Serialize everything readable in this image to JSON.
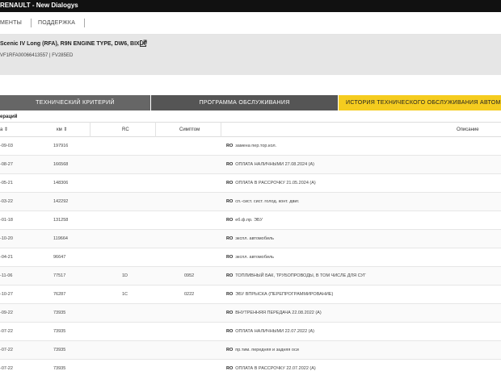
{
  "app": {
    "title": "RENAULT - New Dialogys"
  },
  "menu": {
    "items": [
      "МЕНТЫ",
      "ПОДДЕРЖКА"
    ]
  },
  "vehicle": {
    "title": "Scenic IV Long (RFA), R9N ENGINE TYPE, DW6, BIXUF",
    "subtitle": "VF1RFA00066413557 | FV285ED"
  },
  "tabs": [
    {
      "label": "ТЕХНИЧЕСКИЙ КРИТЕРИЙ",
      "active": false
    },
    {
      "label": "ПРОГРАММА ОБСЛУЖИВАНИЯ",
      "active": false
    },
    {
      "label": "ИСТОРИЯ ТЕХНИЧЕСКОГО ОБСЛУЖИВАНИЯ АВТОМОБИЛЯ",
      "active": true
    }
  ],
  "section_title": "ераций",
  "table": {
    "headers": {
      "date": "а ⇕",
      "km": "км ⇕",
      "rc": "RC",
      "symptom": "Симптом",
      "description": "Описание"
    },
    "badge": "RO",
    "rows": [
      {
        "date": "-09-03",
        "km": "197916",
        "rc": "",
        "symptom": "",
        "description": "замена пер.тор.кол."
      },
      {
        "date": "-08-27",
        "km": "166568",
        "rc": "",
        "symptom": "",
        "description": "ОПЛАТА НАЛИЧНЫМИ 27.08.2024 (A)"
      },
      {
        "date": "-05-21",
        "km": "148306",
        "rc": "",
        "symptom": "",
        "description": "ОПЛАТА В РАССРОЧКУ 21.05.2024 (A)"
      },
      {
        "date": "-03-22",
        "km": "142292",
        "rc": "",
        "symptom": "",
        "description": "сп.-сист. сист. голод. конт. двиг."
      },
      {
        "date": "-01-18",
        "km": "131258",
        "rc": "",
        "symptom": "",
        "description": "еб.ф.пр. ЭБУ"
      },
      {
        "date": "-10-20",
        "km": "119664",
        "rc": "",
        "symptom": "",
        "description": "экспл. автомобиль"
      },
      {
        "date": "-04-21",
        "km": "96647",
        "rc": "",
        "symptom": "",
        "description": "экспл. автомобиль"
      },
      {
        "date": "-11-06",
        "km": "77517",
        "rc": "1D",
        "symptom": "0952",
        "description": "ТОПЛИВНЫЙ БАК, ТРУБОПРОВОДЫ, В ТОМ ЧИСЛЕ ДЛЯ СУГ"
      },
      {
        "date": "-10-27",
        "km": "76287",
        "rc": "1C",
        "symptom": "0222",
        "description": "ЭБУ ВПРЫСКА (ПЕРЕПРОГРАММИРОВАНИЕ)"
      },
      {
        "date": "-09-22",
        "km": "73935",
        "rc": "",
        "symptom": "",
        "description": "ВНУТРЕННЯЯ ПЕРЕДАЧА 22.08.2022 (A)"
      },
      {
        "date": "-07-22",
        "km": "73935",
        "rc": "",
        "symptom": "",
        "description": "ОПЛАТА НАЛИЧНЫМИ 22.07.2022 (A)"
      },
      {
        "date": "-07-22",
        "km": "73935",
        "rc": "",
        "symptom": "",
        "description": "пр.тим. передняя и задняя оси"
      },
      {
        "date": "-07-22",
        "km": "73935",
        "rc": "",
        "symptom": "",
        "description": "ОПЛАТА В РАССРОЧКУ 22.07.2022 (A)"
      }
    ]
  }
}
